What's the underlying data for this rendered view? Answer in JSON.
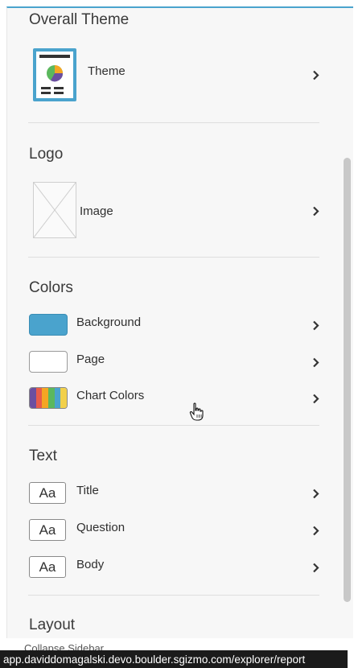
{
  "sections": {
    "theme": {
      "heading": "Overall Theme",
      "items": [
        {
          "label": "Theme",
          "icon": "theme-thumbnail-icon"
        }
      ]
    },
    "logo": {
      "heading": "Logo",
      "items": [
        {
          "label": "Image",
          "icon": "image-placeholder-icon"
        }
      ]
    },
    "colors": {
      "heading": "Colors",
      "items": [
        {
          "label": "Background",
          "swatch": "#4aa3cd"
        },
        {
          "label": "Page",
          "swatch": "#ffffff"
        },
        {
          "label": "Chart Colors",
          "swatch_stripes": [
            "#6b4fa0",
            "#e85c4a",
            "#f5a623",
            "#5bb85d",
            "#4aa3cd",
            "#f2d04a"
          ]
        }
      ]
    },
    "text": {
      "heading": "Text",
      "items": [
        {
          "label": "Title",
          "sample": "Aa"
        },
        {
          "label": "Question",
          "sample": "Aa"
        },
        {
          "label": "Body",
          "sample": "Aa"
        }
      ]
    },
    "layout": {
      "heading": "Layout"
    }
  },
  "footer": {
    "collapse_label": "Collapse Sidebar",
    "status_url": "app.daviddomagalski.devo.boulder.sgizmo.com/explorer/report"
  },
  "colors": {
    "accent": "#4aa3cd",
    "panel_bg": "#f7f7f7"
  }
}
